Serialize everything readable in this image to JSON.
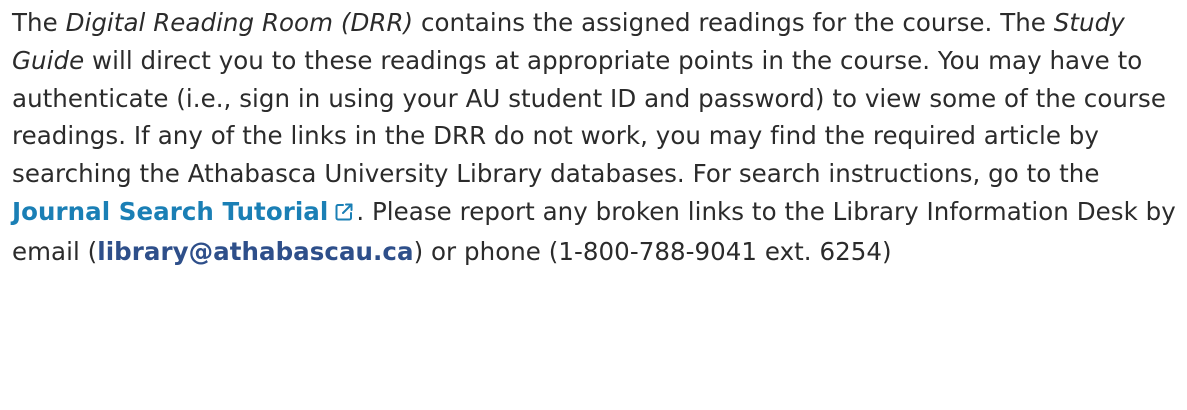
{
  "paragraph": {
    "part1": "The ",
    "drr_title": "Digital Reading Room (DRR)",
    "part2": " contains the assigned readings for the course. The ",
    "study_guide_title": "Study Guide",
    "part3": " will direct you to these readings at appropriate points in the course. You may have to authenticate (i.e., sign in using your AU student ID and password) to view some of the course readings. If any of the links in the DRR do not work, you may find the required article by searching the Athabasca University Library databases. For search instructions, go to the ",
    "tutorial_link": "Journal Search Tutorial",
    "part4": ". Please report any broken links to the Library Information Desk by email (",
    "email_link": "library@athabascau.ca",
    "part5": ") or phone (1-800-788-9041 ext. 6254)"
  },
  "icons": {
    "external_link": "external-link-icon"
  },
  "colors": {
    "text": "#2b2b2b",
    "link": "#1a7fb5",
    "email": "#2e4f8a"
  }
}
